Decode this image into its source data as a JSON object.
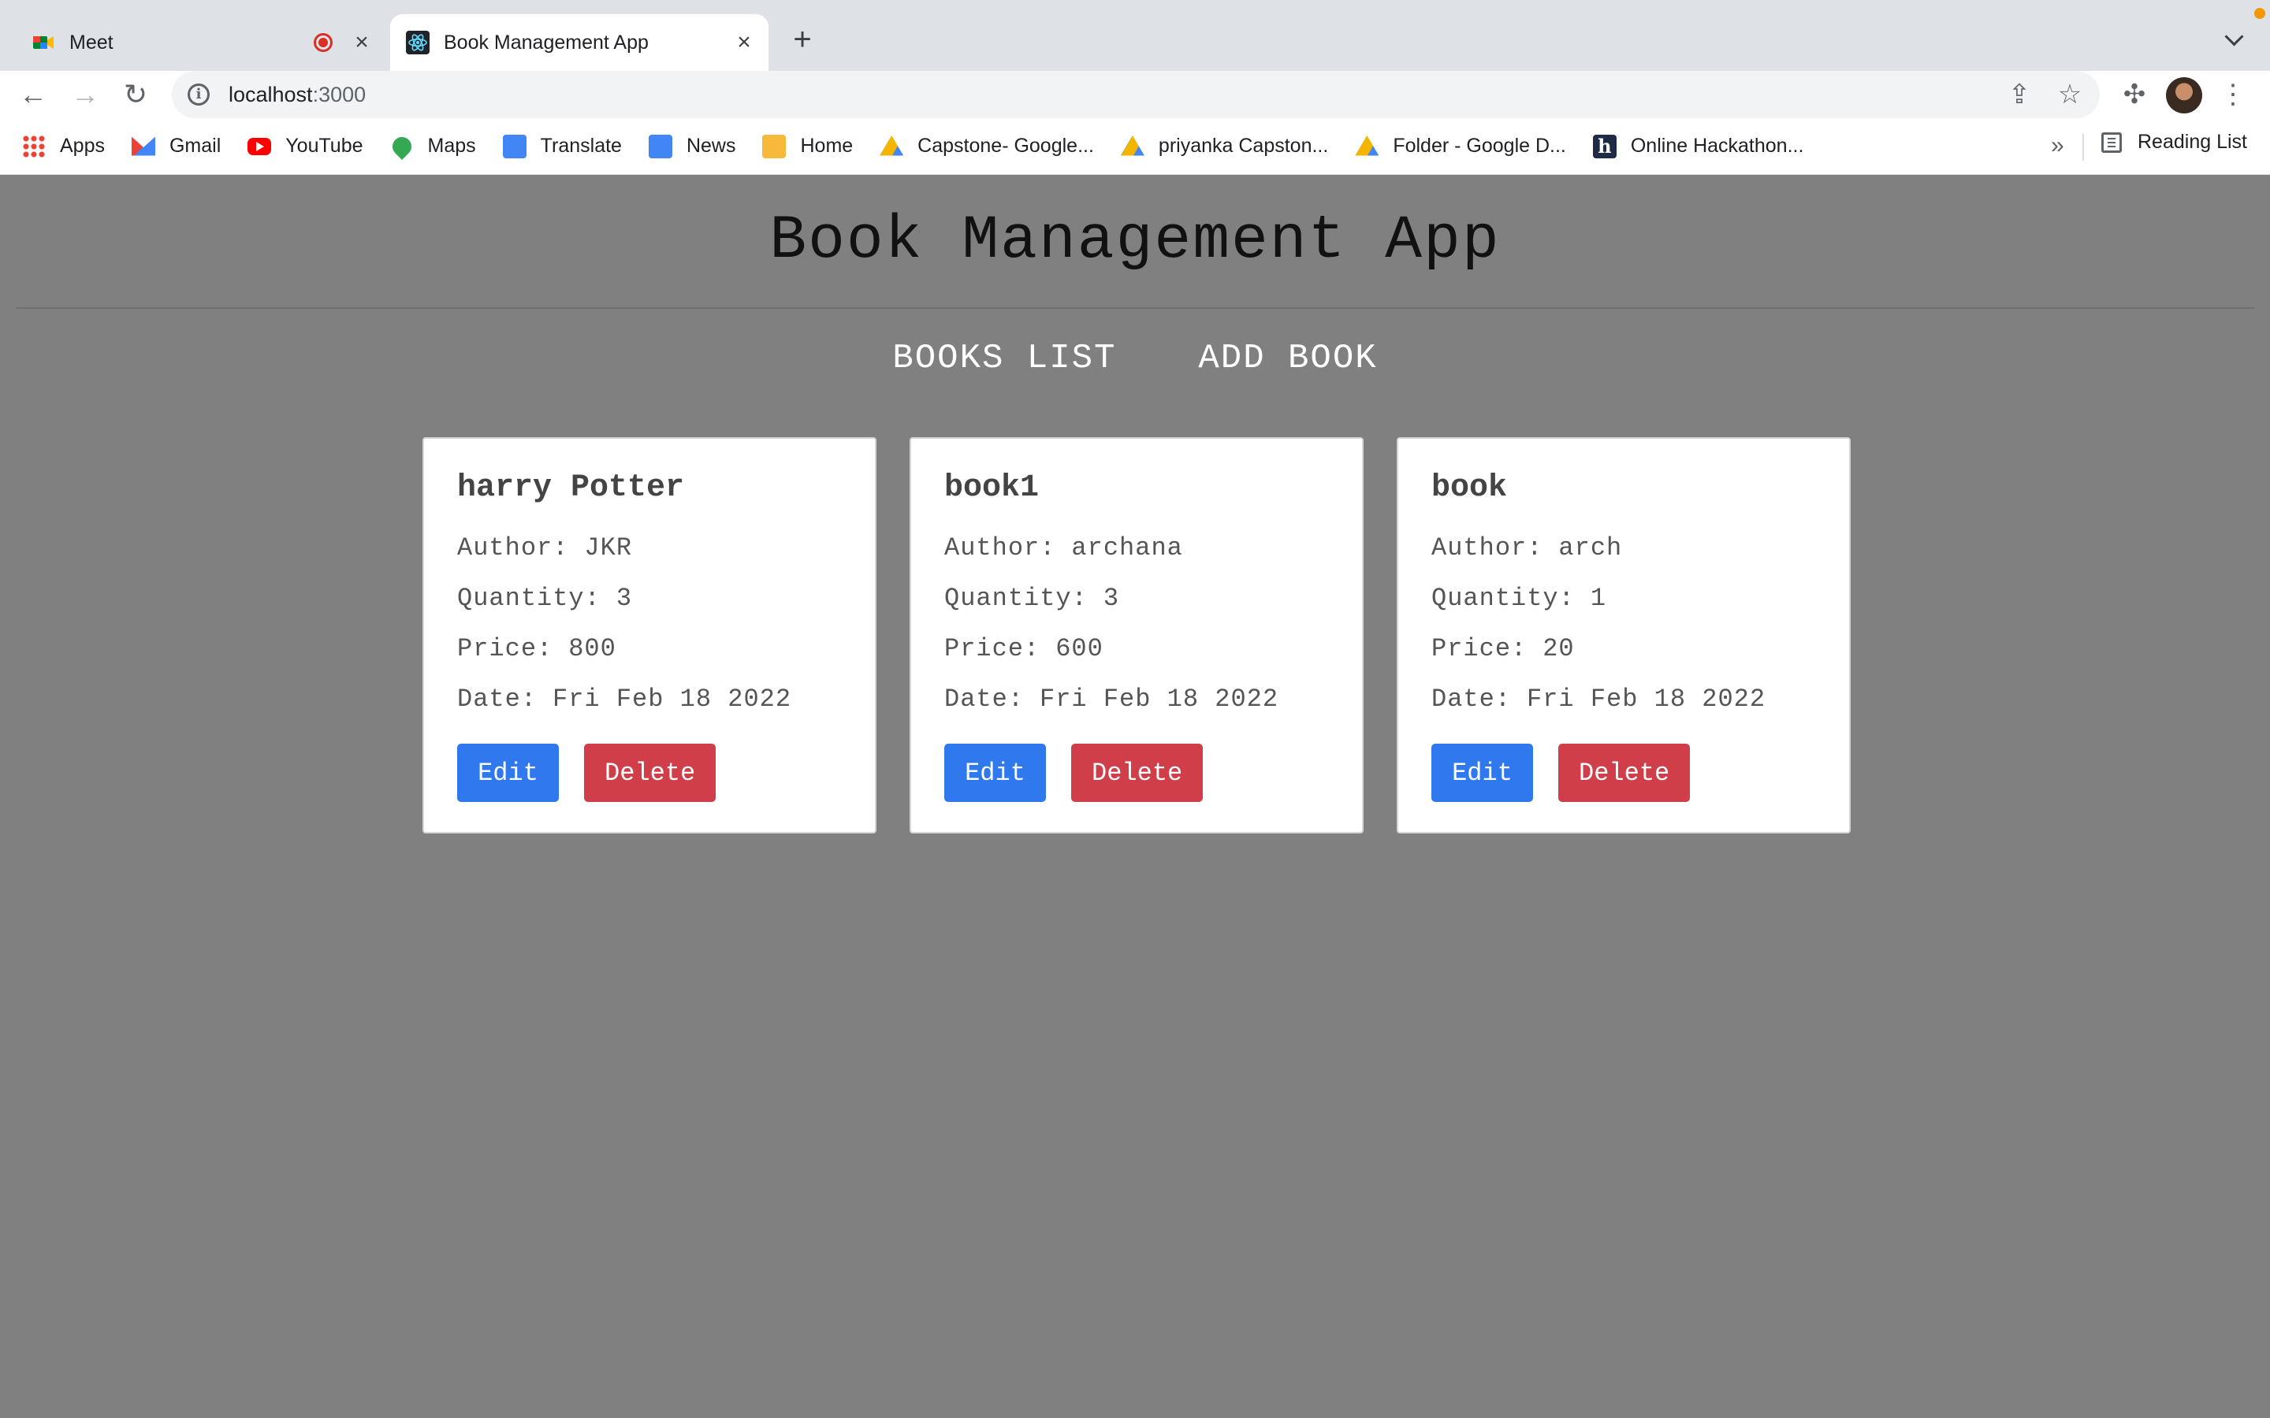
{
  "browser": {
    "tabs": [
      {
        "title": "Meet",
        "active": false,
        "recording": true
      },
      {
        "title": "Book Management App",
        "active": true
      }
    ],
    "new_tab_label": "+",
    "address": {
      "host": "localhost",
      "port": ":3000"
    },
    "bookmarks": [
      {
        "label": "Apps",
        "icon": "apps-grid-icon"
      },
      {
        "label": "Gmail",
        "icon": "gmail-icon"
      },
      {
        "label": "YouTube",
        "icon": "youtube-icon"
      },
      {
        "label": "Maps",
        "icon": "maps-icon"
      },
      {
        "label": "Translate",
        "icon": "translate-icon"
      },
      {
        "label": "News",
        "icon": "news-icon"
      },
      {
        "label": "Home",
        "icon": "home-icon"
      },
      {
        "label": "Capstone- Google...",
        "icon": "google-drive-icon"
      },
      {
        "label": "priyanka Capston...",
        "icon": "google-drive-icon"
      },
      {
        "label": "Folder - Google D...",
        "icon": "google-drive-icon"
      },
      {
        "label": "Online Hackathon...",
        "icon": "hackerearth-icon"
      }
    ],
    "bookmarks_more": "»",
    "reading_list": "Reading List"
  },
  "app": {
    "title": "Book Management App",
    "nav": {
      "books_list": "BOOKS LIST",
      "add_book": "ADD BOOK"
    },
    "labels": {
      "author": "Author:",
      "quantity": "Quantity:",
      "price": "Price:",
      "date": "Date:"
    },
    "buttons": {
      "edit": "Edit",
      "delete": "Delete"
    },
    "books": [
      {
        "title": "harry Potter",
        "author": "JKR",
        "quantity": "3",
        "price": "800",
        "date": "Fri Feb 18 2022"
      },
      {
        "title": "book1",
        "author": "archana",
        "quantity": "3",
        "price": "600",
        "date": "Fri Feb 18 2022"
      },
      {
        "title": "book",
        "author": "arch",
        "quantity": "1",
        "price": "20",
        "date": "Fri Feb 18 2022"
      }
    ]
  },
  "colors": {
    "page_bg": "#808080",
    "edit_btn": "#2f78ed",
    "delete_btn": "#cf3e49"
  }
}
